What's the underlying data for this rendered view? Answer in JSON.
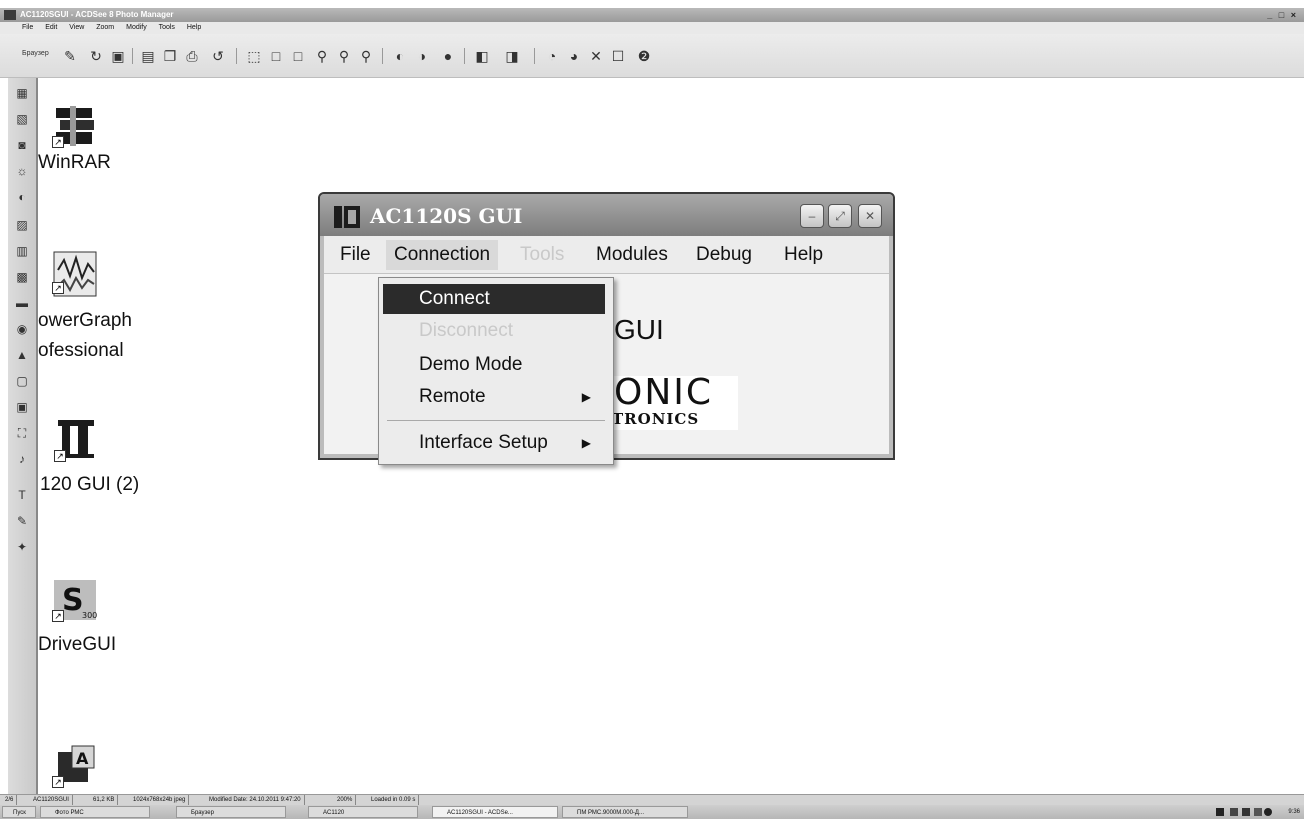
{
  "acdsee": {
    "title": "AC1120SGUI - ACDSee 8 Photo Manager",
    "window_controls": "_ □ ×",
    "menu": [
      "File",
      "Edit",
      "View",
      "Zoom",
      "Modify",
      "Tools",
      "Help"
    ],
    "browse_label": "Браузер"
  },
  "desktop": {
    "icons": [
      {
        "label": "WinRAR"
      },
      {
        "label": "owerGraph",
        "label2": "ofessional"
      },
      {
        "label": "120 GUI (2)"
      },
      {
        "label": "DriveGUI"
      },
      {
        "label": ""
      }
    ]
  },
  "window": {
    "title": "AC1120S GUI",
    "menu": {
      "file": "File",
      "connection": "Connection",
      "tools": "Tools",
      "modules": "Modules",
      "debug": "Debug",
      "help": "Help"
    },
    "body_text": "GUI",
    "brand_top": "ONIC",
    "brand_bottom": "TRONICS"
  },
  "dropdown": {
    "connect": "Connect",
    "disconnect": "Disconnect",
    "demo_mode": "Demo Mode",
    "remote": "Remote",
    "interface_setup": "Interface Setup"
  },
  "statusbar": {
    "index": "2/6",
    "filename": "AC1120SGUI",
    "size": "61,2 KB",
    "dimensions": "1024x768x24b jpeg",
    "modified": "Modified Date: 24.10.2011 9:47:20",
    "zoom": "200%",
    "loaded": "Loaded in 0.09 s"
  },
  "taskbar": {
    "start": "Пуск",
    "items": [
      "Фото РМС",
      "Браузер",
      "AC1120",
      "AC1120SGUI - ACDSe...",
      "ПМ РМС.9000М.000-Д..."
    ],
    "clock": "9:36"
  },
  "colors": {
    "highlight": "#2b2b2b",
    "disabled_text": "#c9c9c9"
  }
}
